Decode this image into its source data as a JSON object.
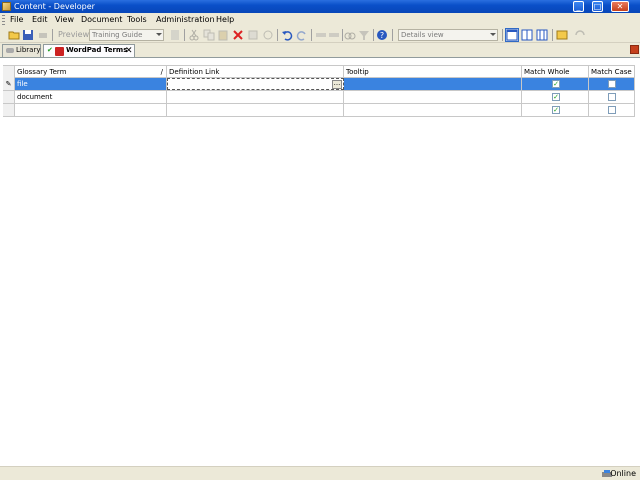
{
  "window": {
    "title": "Content - Developer"
  },
  "menu": {
    "items": [
      "File",
      "Edit",
      "View",
      "Document",
      "Tools",
      "Administration",
      "Help"
    ]
  },
  "toolbar": {
    "preview_label": "Preview",
    "outline_combo": "Training Guide",
    "view_combo": "Details view",
    "icons": [
      "open-icon",
      "save-icon",
      "print-icon",
      "preview-icon",
      "cut-icon",
      "copy-icon",
      "paste-icon",
      "delete-icon",
      "undo-icon",
      "redo-icon",
      "find-icon",
      "help-icon",
      "layout-icon",
      "refresh-icon"
    ]
  },
  "tabs": [
    {
      "label": "Library",
      "active": false
    },
    {
      "label": "WordPad Terms",
      "active": true
    }
  ],
  "grid": {
    "columns": [
      "Glossary Term",
      "Definition Link",
      "Tooltip",
      "Match Whole Word",
      "Match Case"
    ],
    "rows": [
      {
        "selector": "✎",
        "term": "file",
        "link": "",
        "tooltip": "",
        "match_whole_word": true,
        "match_case": false,
        "selected": true
      },
      {
        "selector": "",
        "term": "document",
        "link": "",
        "tooltip": "",
        "match_whole_word": true,
        "match_case": false,
        "selected": false
      },
      {
        "selector": "",
        "term": "",
        "link": "",
        "tooltip": "",
        "match_whole_word": true,
        "match_case": false,
        "selected": false
      }
    ]
  },
  "status": {
    "text": "Online"
  },
  "colors": {
    "title_blue": "#0a4fc9",
    "selection_blue": "#3a83e0",
    "chrome": "#ece9d8"
  }
}
